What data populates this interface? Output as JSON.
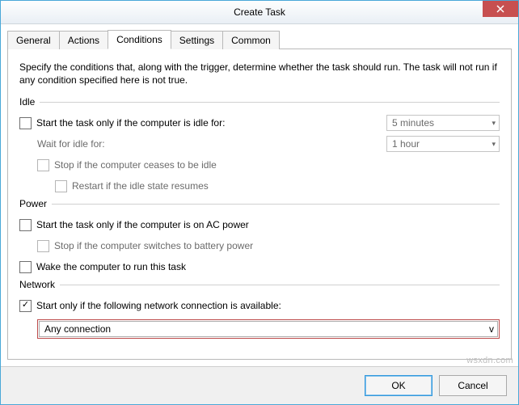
{
  "window": {
    "title": "Create Task"
  },
  "tabs": {
    "general": "General",
    "actions": "Actions",
    "conditions": "Conditions",
    "settings": "Settings",
    "common": "Common"
  },
  "desc": "Specify the conditions that, along with the trigger, determine whether the task should run. The task will not run if any condition specified here is not true.",
  "idle": {
    "header": "Idle",
    "start_if_idle": "Start the task only if the computer is idle for:",
    "wait_label": "Wait for idle for:",
    "stop_if_not_idle": "Stop if the computer ceases to be idle",
    "restart_idle": "Restart if the idle state resumes",
    "idle_duration": "5 minutes",
    "idle_wait": "1 hour"
  },
  "power": {
    "header": "Power",
    "ac_only": "Start the task only if the computer is on AC power",
    "stop_on_battery": "Stop if the computer switches to battery power",
    "wake": "Wake the computer to run this task"
  },
  "network": {
    "header": "Network",
    "start_if_net": "Start only if the following network connection is available:",
    "connection": "Any connection"
  },
  "buttons": {
    "ok": "OK",
    "cancel": "Cancel"
  },
  "watermark": "wsxdn.com"
}
